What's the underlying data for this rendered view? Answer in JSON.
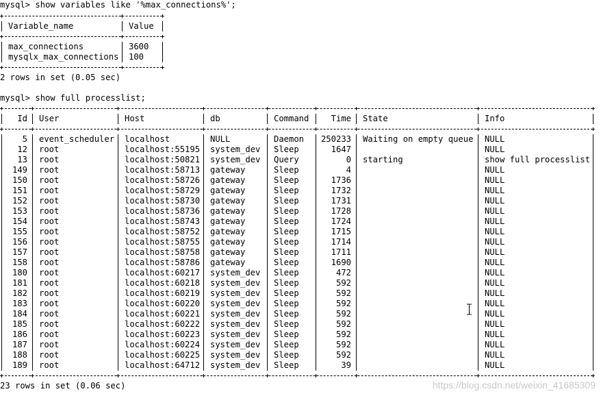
{
  "prompt": "mysql>",
  "query1": {
    "command": "show variables like '%max_connections%';",
    "columns": [
      "Variable_name",
      "Value"
    ],
    "rows": [
      [
        "max_connections",
        "3600"
      ],
      [
        "mysqlx_max_connections",
        "100"
      ]
    ],
    "summary": "2 rows in set (0.05 sec)"
  },
  "query2": {
    "command": "show full processlist;",
    "columns": [
      "Id",
      "User",
      "Host",
      "db",
      "Command",
      "Time",
      "State",
      "Info"
    ],
    "rows": [
      [
        "5",
        "event_scheduler",
        "localhost",
        "NULL",
        "Daemon",
        "250233",
        "Waiting on empty queue",
        "NULL"
      ],
      [
        "12",
        "root",
        "localhost:55195",
        "system_dev",
        "Sleep",
        "1647",
        "",
        "NULL"
      ],
      [
        "13",
        "root",
        "localhost:50821",
        "system_dev",
        "Query",
        "0",
        "starting",
        "show full processlist"
      ],
      [
        "149",
        "root",
        "localhost:58713",
        "gateway",
        "Sleep",
        "4",
        "",
        "NULL"
      ],
      [
        "150",
        "root",
        "localhost:58726",
        "gateway",
        "Sleep",
        "1736",
        "",
        "NULL"
      ],
      [
        "151",
        "root",
        "localhost:58729",
        "gateway",
        "Sleep",
        "1732",
        "",
        "NULL"
      ],
      [
        "152",
        "root",
        "localhost:58730",
        "gateway",
        "Sleep",
        "1731",
        "",
        "NULL"
      ],
      [
        "153",
        "root",
        "localhost:58736",
        "gateway",
        "Sleep",
        "1728",
        "",
        "NULL"
      ],
      [
        "154",
        "root",
        "localhost:58743",
        "gateway",
        "Sleep",
        "1724",
        "",
        "NULL"
      ],
      [
        "155",
        "root",
        "localhost:58752",
        "gateway",
        "Sleep",
        "1715",
        "",
        "NULL"
      ],
      [
        "156",
        "root",
        "localhost:58755",
        "gateway",
        "Sleep",
        "1714",
        "",
        "NULL"
      ],
      [
        "157",
        "root",
        "localhost:58758",
        "gateway",
        "Sleep",
        "1711",
        "",
        "NULL"
      ],
      [
        "158",
        "root",
        "localhost:58786",
        "gateway",
        "Sleep",
        "1690",
        "",
        "NULL"
      ],
      [
        "180",
        "root",
        "localhost:60217",
        "system_dev",
        "Sleep",
        "472",
        "",
        "NULL"
      ],
      [
        "181",
        "root",
        "localhost:60218",
        "system_dev",
        "Sleep",
        "592",
        "",
        "NULL"
      ],
      [
        "182",
        "root",
        "localhost:60219",
        "system_dev",
        "Sleep",
        "592",
        "",
        "NULL"
      ],
      [
        "183",
        "root",
        "localhost:60220",
        "system_dev",
        "Sleep",
        "592",
        "",
        "NULL"
      ],
      [
        "184",
        "root",
        "localhost:60221",
        "system_dev",
        "Sleep",
        "592",
        "",
        "NULL"
      ],
      [
        "185",
        "root",
        "localhost:60222",
        "system_dev",
        "Sleep",
        "592",
        "",
        "NULL"
      ],
      [
        "186",
        "root",
        "localhost:60223",
        "system_dev",
        "Sleep",
        "592",
        "",
        "NULL"
      ],
      [
        "187",
        "root",
        "localhost:60224",
        "system_dev",
        "Sleep",
        "592",
        "",
        "NULL"
      ],
      [
        "188",
        "root",
        "localhost:60225",
        "system_dev",
        "Sleep",
        "592",
        "",
        "NULL"
      ],
      [
        "189",
        "root",
        "localhost:64712",
        "system_dev",
        "Sleep",
        "39",
        "",
        "NULL"
      ]
    ],
    "summary": "23 rows in set (0.06 sec)"
  },
  "watermark": "https://blog.csdn.net/weixin_41685309",
  "cursor_icon": "text-cursor-icon",
  "colors": {
    "background": "#ffffff",
    "text": "#000000",
    "watermark": "#c8c8c8"
  }
}
